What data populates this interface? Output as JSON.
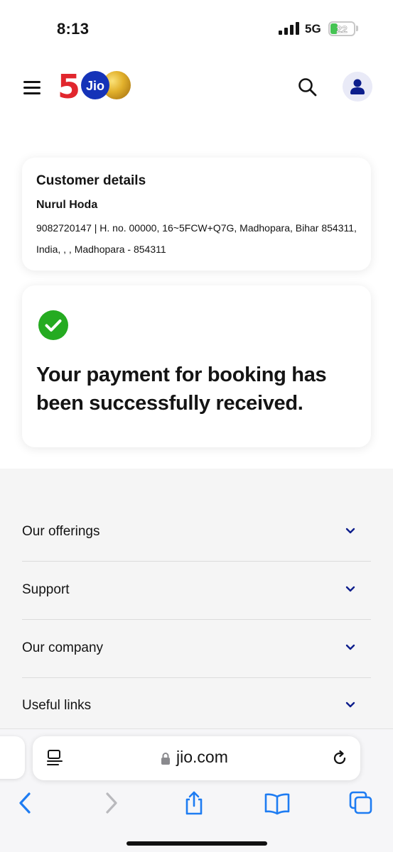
{
  "status_bar": {
    "time": "8:13",
    "network": "5G",
    "battery": "22"
  },
  "header": {
    "logo": {
      "numeral": "5",
      "brand": "Jio"
    },
    "menu_icon": "hamburger-icon",
    "search_icon": "search-icon",
    "profile_icon": "user-icon"
  },
  "customer": {
    "title": "Customer details",
    "name": "Nurul Hoda",
    "address": "9082720147 | H. no. 00000, 16~5FCW+Q7G, Madhopara, Bihar 854311, India, , , Madhopara - 854311"
  },
  "payment": {
    "status_icon": "check-circle-icon",
    "message": "Your payment for booking has been successfully received."
  },
  "footer": {
    "sections": [
      {
        "label": "Our offerings"
      },
      {
        "label": "Support"
      },
      {
        "label": "Our company"
      },
      {
        "label": "Useful links"
      }
    ]
  },
  "browser": {
    "url": "jio.com",
    "toolbar_icons": [
      "back-icon",
      "forward-icon",
      "share-icon",
      "bookmarks-icon",
      "tabs-icon"
    ]
  },
  "colors": {
    "jio_blue": "#1533b8",
    "jio_red": "#e1262d",
    "gold": "#d9a520",
    "success_green": "#25ab21",
    "ios_blue": "#1e7cf2",
    "text": "#141414",
    "footer_bg": "#f5f5f5"
  }
}
